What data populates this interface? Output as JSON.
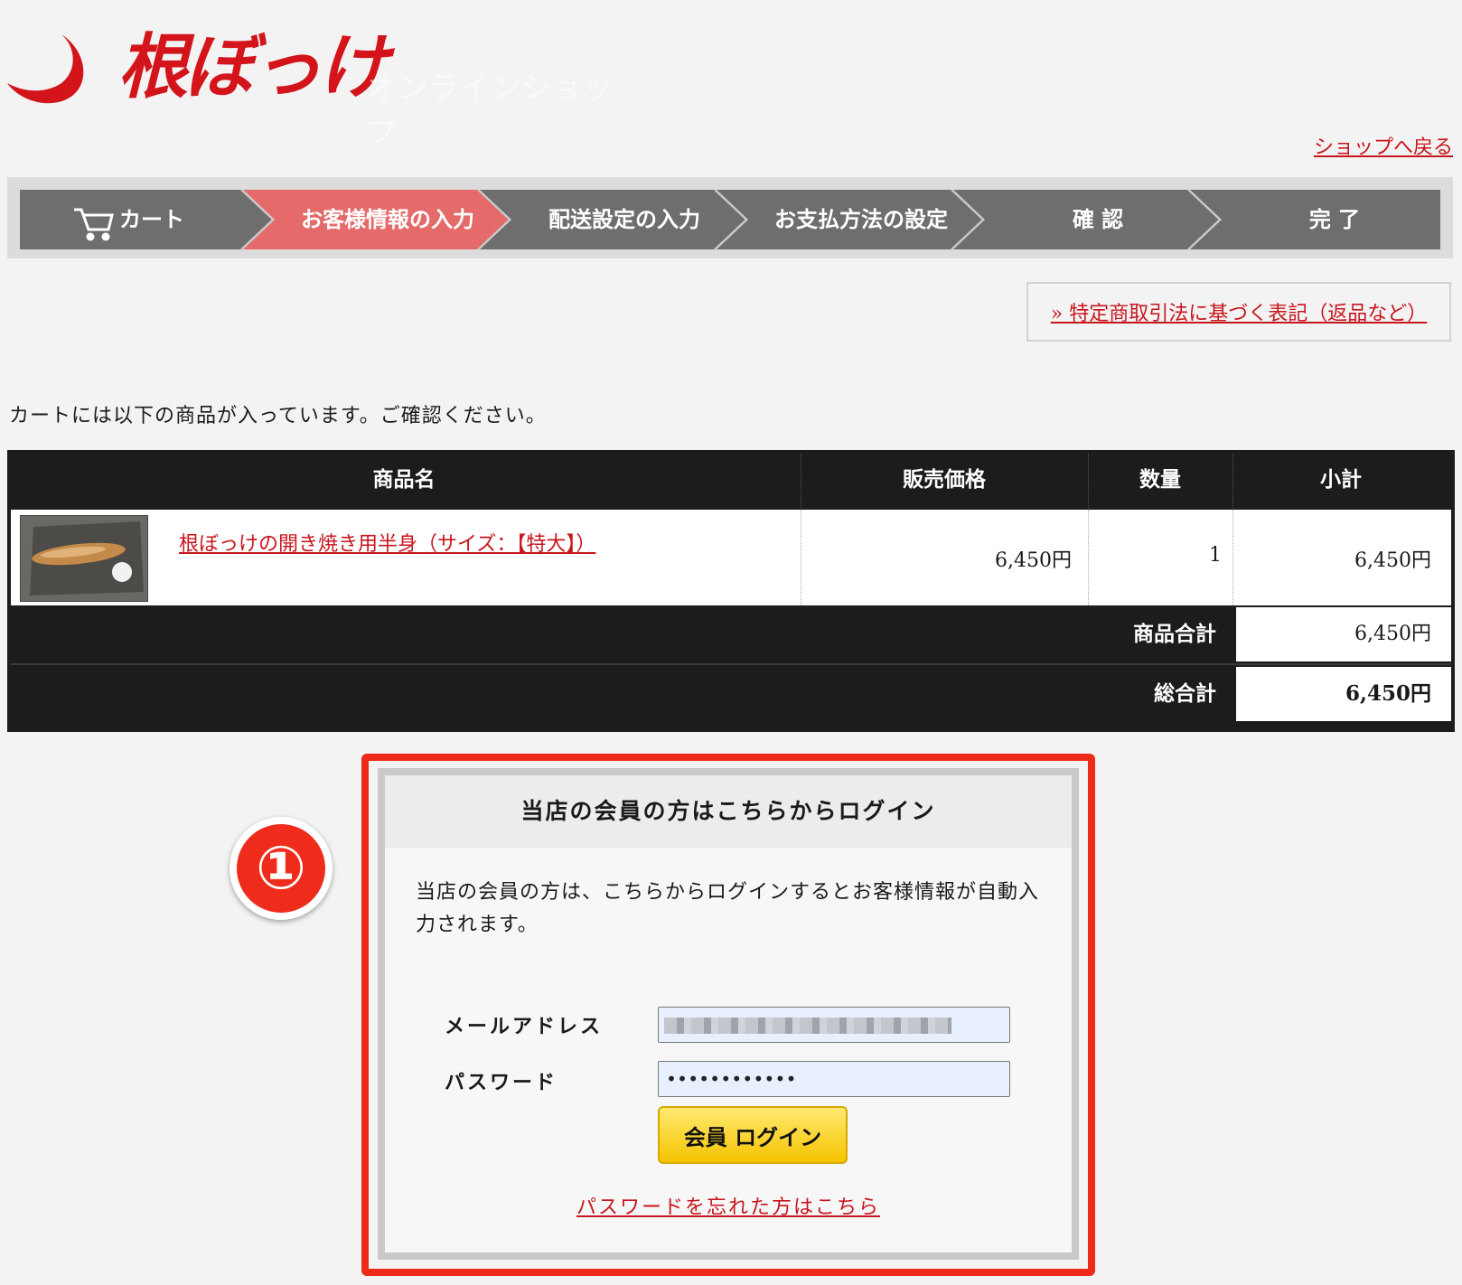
{
  "brand": {
    "logo_text": "根ぼっけ",
    "logo_sub": "オンラインショップ"
  },
  "nav": {
    "back_to_shop": "ショップへ戻る"
  },
  "steps": [
    {
      "label": "カート",
      "icon": "cart-icon",
      "active": false
    },
    {
      "label": "お客様情報の入力",
      "active": true
    },
    {
      "label": "配送設定の入力",
      "active": false
    },
    {
      "label": "お支払方法の設定",
      "active": false
    },
    {
      "label": "確 認",
      "active": false
    },
    {
      "label": "完 了",
      "active": false
    }
  ],
  "colors": {
    "step_active": "#e56a6a",
    "step_inactive": "#6e6e6e",
    "accent": "#c8161d",
    "frame": "#ee2a1a",
    "button": "#f5c400"
  },
  "legal_link": "» 特定商取引法に基づく表記（返品など）",
  "intro_text": "カートには以下の商品が入っています。ご確認ください。",
  "cart": {
    "headers": {
      "name": "商品名",
      "price": "販売価格",
      "qty": "数量",
      "subtotal": "小計"
    },
    "items": [
      {
        "name": "根ぼっけの開き焼き用半身（サイズ：【特大】）",
        "price": "6,450円",
        "qty": "1",
        "subtotal": "6,450円"
      }
    ],
    "product_total_label": "商品合計",
    "product_total": "6,450円",
    "grand_total_label": "総合計",
    "grand_total": "6,450円"
  },
  "annotation": {
    "badge": "①"
  },
  "login": {
    "title": "当店の会員の方はこちらからログイン",
    "description": "当店の会員の方は、こちらからログインするとお客様情報が自動入力されます。",
    "email_label": "メールアドレス",
    "password_label": "パスワード",
    "password_value": "••••••••••••",
    "button_label": "会員 ログイン",
    "forgot_link": "パスワードを忘れた方はこちら"
  }
}
